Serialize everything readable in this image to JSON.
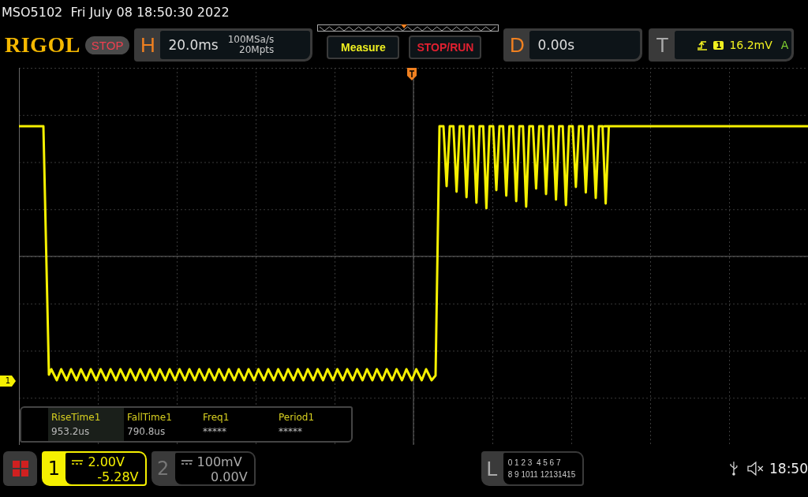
{
  "header": {
    "model": "MSO5102",
    "datetime": "Fri July 08 18:50:30 2022"
  },
  "toolbar": {
    "logo": "RIGOL",
    "run_state": "STOP",
    "horizontal": {
      "label": "H",
      "timebase": "20.0ms",
      "sample_rate": "100MSa/s",
      "memory_depth": "20Mpts"
    },
    "buttons": [
      {
        "label": "Measure",
        "color": "#f0f020"
      },
      {
        "label": "STOP/RUN",
        "color": "#e02030"
      }
    ],
    "delay": {
      "label": "D",
      "value": "0.00s"
    },
    "trigger": {
      "label": "T",
      "source": "1",
      "level": "16.2mV",
      "mode": "A"
    }
  },
  "waveform": {
    "channel_marker": "1"
  },
  "measurements": [
    {
      "name": "RiseTime1",
      "value": "953.2us",
      "selected": true
    },
    {
      "name": "FallTime1",
      "value": "790.8us",
      "selected": false
    },
    {
      "name": "Freq1",
      "value": "*****",
      "selected": false
    },
    {
      "name": "Period1",
      "value": "*****",
      "selected": false
    }
  ],
  "channels": [
    {
      "number": "1",
      "scale": "2.00V",
      "offset": "-5.28V",
      "selected": true
    },
    {
      "number": "2",
      "scale": "100mV",
      "offset": "0.00V",
      "selected": false
    }
  ],
  "logic": {
    "label": "L",
    "row_1": "0 1 2 3  4 5 6 7",
    "row_2": "8 9 1011 12131415"
  },
  "status": {
    "time": "18:50"
  }
}
